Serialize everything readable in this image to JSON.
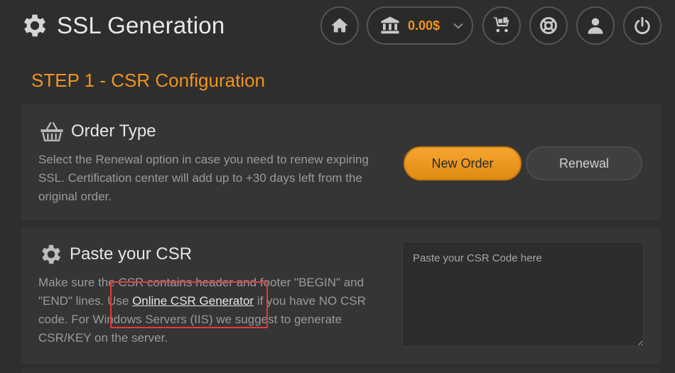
{
  "header": {
    "title": "SSL Generation",
    "balance": "0.00$",
    "icons": {
      "home": "home-icon",
      "bank": "bank-icon",
      "cart": "cart-icon",
      "support": "lifebuoy-icon",
      "account": "user-icon",
      "logout": "power-icon"
    }
  },
  "step": {
    "title": "STEP 1 - CSR Configuration"
  },
  "order_type": {
    "heading": "Order Type",
    "description": "Select the Renewal option in case you need to renew expiring SSL. Certification center will add up to +30 days left from the original order.",
    "new_order_label": "New Order",
    "renewal_label": "Renewal",
    "selected": "New Order"
  },
  "csr": {
    "heading": "Paste your CSR",
    "desc_before": "Make sure the CSR contains header and footer \"BEGIN\" and \"END\" lines. Use ",
    "link_text": "Online CSR Generator",
    "desc_after": " if you have NO CSR code. For Windows Servers (IIS) we suggest to generate CSR/KEY on the server.",
    "placeholder": "Paste your CSR Code here",
    "value": ""
  },
  "colors": {
    "accent": "#f0941e",
    "background": "#2e2e2e",
    "panel": "#353535",
    "highlight": "#e23b3b"
  }
}
